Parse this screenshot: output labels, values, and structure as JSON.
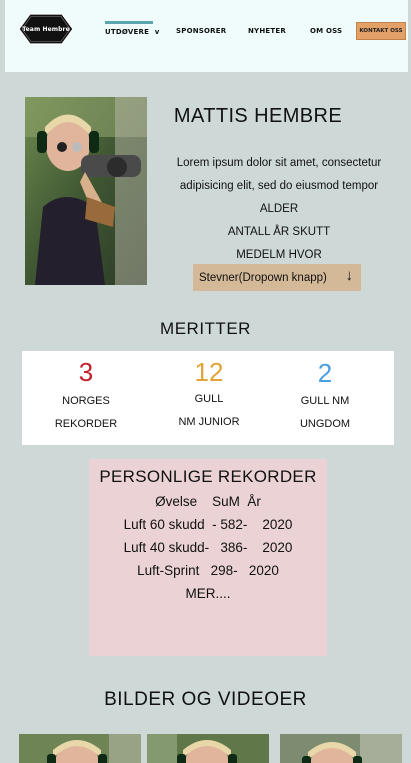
{
  "nav": {
    "logo_text": "Team Hembre",
    "items": [
      {
        "label": "UTDØVERE",
        "has_dropdown": true,
        "active": true
      },
      {
        "label": "SPONSORER"
      },
      {
        "label": "NYHETER"
      },
      {
        "label": "OM OSS"
      }
    ],
    "dropdown_indicator": "v",
    "cta_label": "KONTAKT OSS"
  },
  "profile": {
    "name": "MATTIS HEMBRE",
    "intro_line1": "Lorem ipsum dolor sit amet, consectetur",
    "intro_line2": "adipisicing elit, sed do eiusmod tempor",
    "age_label": "ALDER",
    "years_label": "ANTALL ÅR SKUTT",
    "member_label": "MEDELM HVOR",
    "dropdown_label": "Stevner(Dropown knapp)",
    "dropdown_arrow": "↓"
  },
  "meritter": {
    "title": "MERITTER",
    "items": [
      {
        "value": "3",
        "line1": "NORGES",
        "line2": "REKORDER",
        "color": "#c4202c"
      },
      {
        "value": "12",
        "line1": "GULL",
        "line2": "NM JUNIOR",
        "color": "#e2a338"
      },
      {
        "value": "2",
        "line1": "GULL NM",
        "line2": "UNGDOM",
        "color": "#4a9fdf"
      }
    ]
  },
  "records": {
    "title": "PERSONLIGE REKORDER",
    "header": "Øvelse    SuM  År",
    "rows": [
      "Luft 60 skudd  - 582-    2020",
      "Luft 40 skudd-   386-    2020",
      "Luft-Sprint   298-   2020"
    ],
    "more": "MER...."
  },
  "media": {
    "title": "BILDER OG VIDEOER"
  },
  "colors": {
    "background": "#cdd8d7",
    "header_bg": "#effcfb",
    "cta": "#e3a168",
    "dropdown_bg": "#d3b998",
    "records_bg": "#ebd3d5",
    "accent_underline": "#5aa7b0"
  }
}
